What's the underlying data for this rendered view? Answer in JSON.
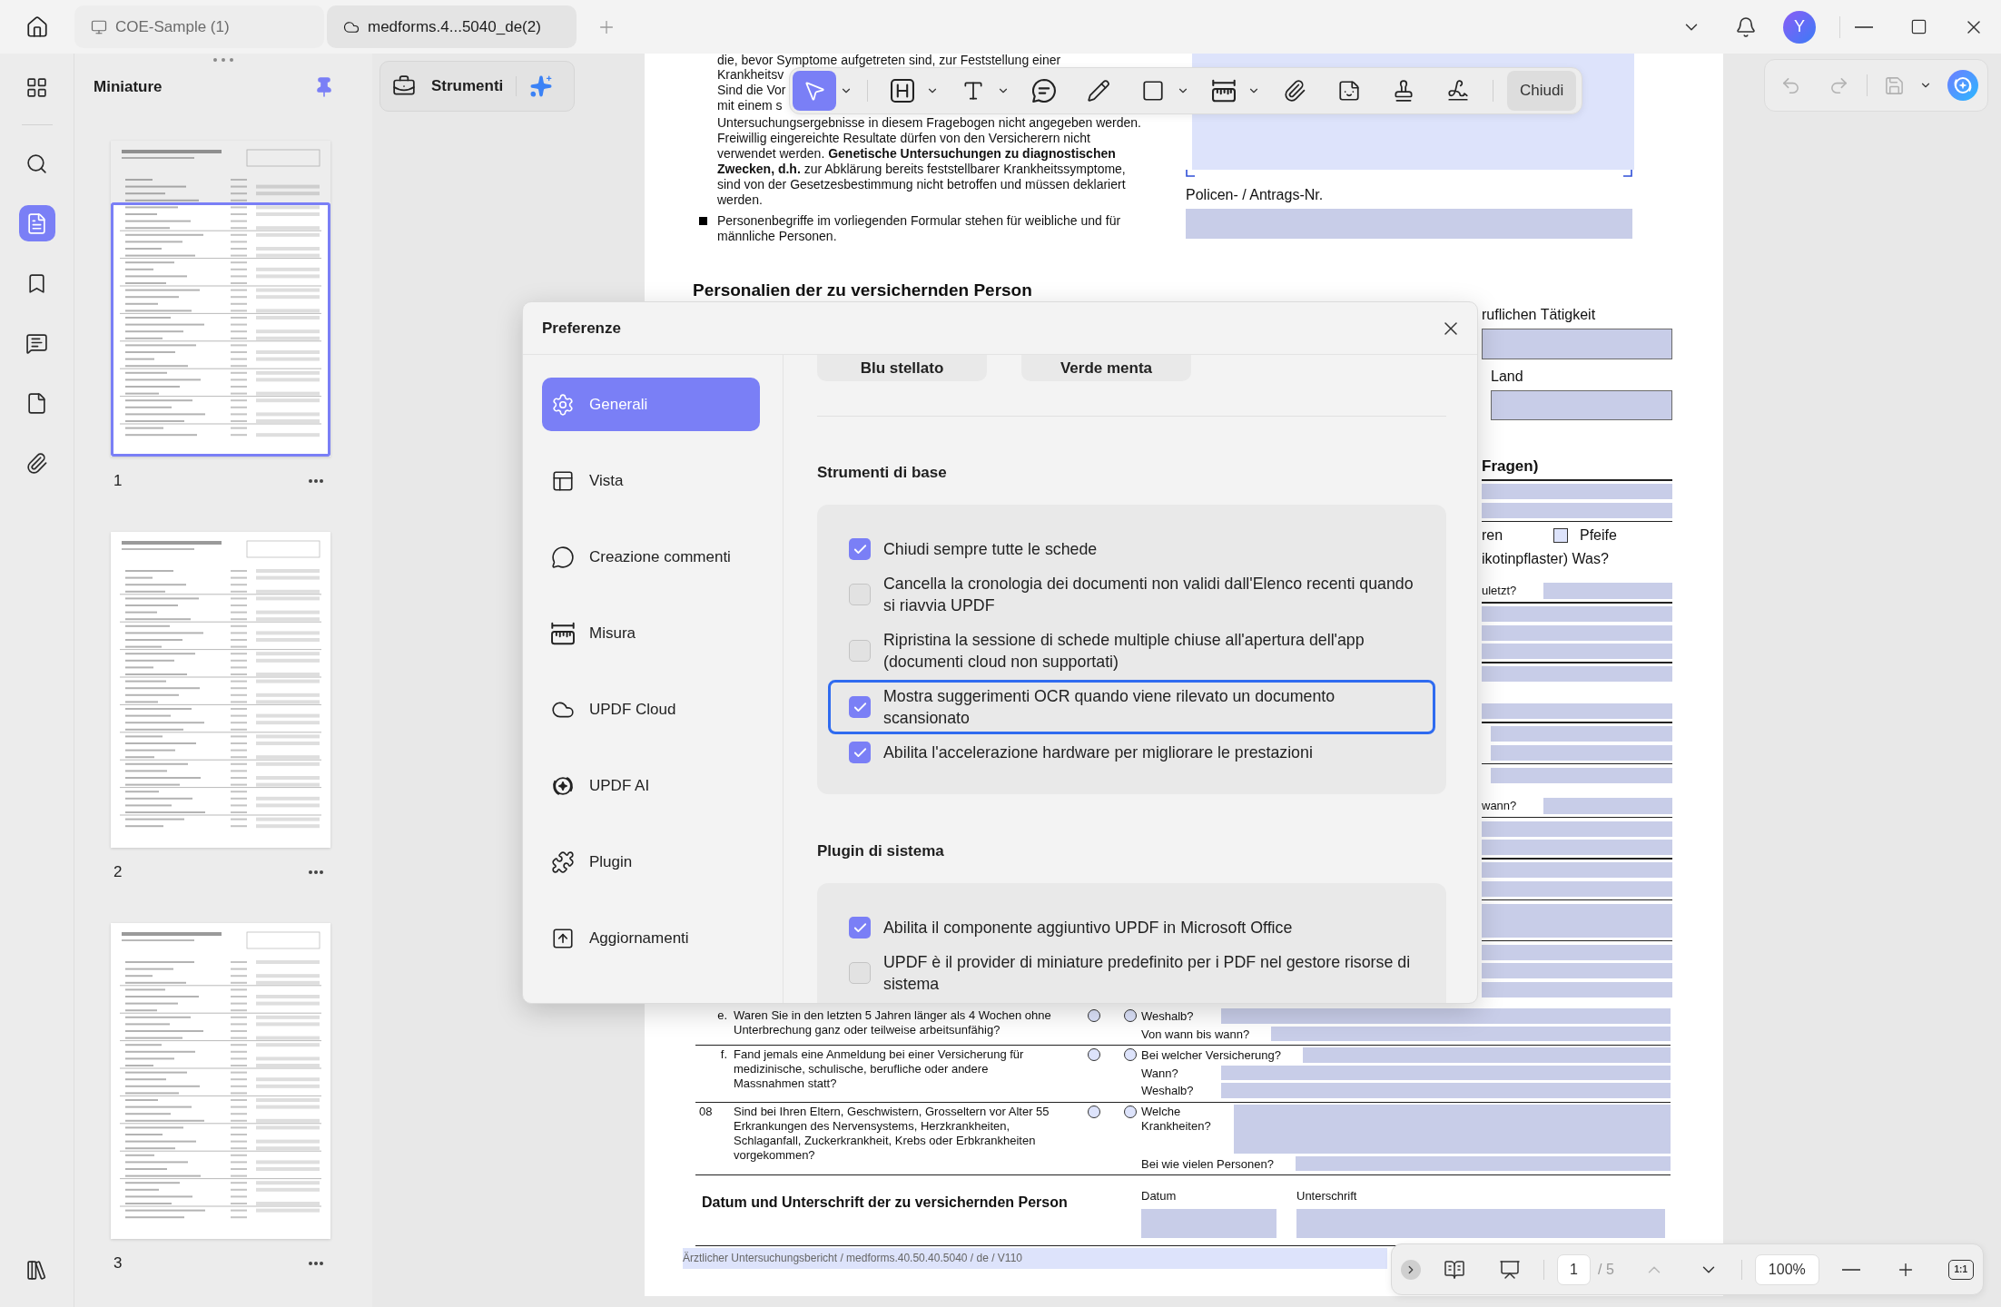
{
  "title_bar": {
    "tabs": [
      {
        "kind": "local",
        "label": "COE-Sample (1)",
        "selected": false
      },
      {
        "kind": "cloud",
        "label": "medforms.4...5040_de(2)",
        "selected": true
      }
    ],
    "avatar": "Y"
  },
  "rail": [
    {
      "kind": "apps",
      "selected": false
    },
    {
      "kind": "search",
      "selected": false
    },
    {
      "kind": "pages",
      "selected": true
    },
    {
      "kind": "bookmarks",
      "selected": false
    },
    {
      "kind": "comments",
      "selected": false
    },
    {
      "kind": "forms",
      "selected": false
    },
    {
      "kind": "attachments",
      "selected": false
    },
    {
      "kind": "library",
      "selected": false
    }
  ],
  "thumbnails": {
    "title": "Miniature",
    "pinned": true,
    "pages": [
      {
        "label": "1",
        "selected": true
      },
      {
        "label": "2",
        "selected": false
      },
      {
        "label": "3",
        "selected": false
      }
    ]
  },
  "tools_button": {
    "label": "Strumenti"
  },
  "toolbar": {
    "tools": [
      {
        "kind": "select",
        "selected": true,
        "has_menu": true
      },
      {
        "kind": "text_box",
        "selected": false,
        "has_menu": true
      },
      {
        "kind": "text",
        "selected": false,
        "has_menu": true
      },
      {
        "kind": "comment",
        "selected": false,
        "has_menu": false
      },
      {
        "kind": "pencil",
        "selected": false,
        "has_menu": false
      },
      {
        "kind": "shape",
        "selected": false,
        "has_menu": true
      },
      {
        "kind": "measure",
        "selected": false,
        "has_menu": true
      },
      {
        "kind": "attach",
        "selected": false,
        "has_menu": false
      },
      {
        "kind": "sticker",
        "selected": false,
        "has_menu": false
      },
      {
        "kind": "stamp",
        "selected": false,
        "has_menu": false
      },
      {
        "kind": "signature",
        "selected": false,
        "has_menu": false
      }
    ],
    "close_label": "Chiudi"
  },
  "history": [
    {
      "kind": "undo",
      "disabled": true
    },
    {
      "kind": "redo",
      "disabled": true
    },
    {
      "kind": "save",
      "disabled": true
    }
  ],
  "document": {
    "intro_lines": [
      "die, bevor Symptome aufgetreten sind, zur Feststellung einer",
      "Krankheitsv",
      "Sind die Vor",
      "mit einem s"
    ],
    "paragraph_lines": [
      "Untersuchungsergebnisse in diesem Fragebogen nicht angegeben werden.",
      "Freiwillig eingereichte Resultate dürfen von den Versicherern nicht",
      "verwendet werden. **Genetische Untersuchungen zu diagnostischen**",
      "**Zwecken, d.h.** zur Abklärung bereits feststellbarer Krankheitssymptome,",
      "sind von der Gesetzesbestimmung nicht betroffen und müssen deklariert",
      "werden."
    ],
    "bullet_lines": [
      "Personenbegriffe im vorliegenden Formular stehen für weibliche und für",
      "männliche Personen."
    ],
    "policy_label": "Policen- / Antrags-Nr.",
    "section_title": "Personalien der zu versichernden Person",
    "side_rows": [
      {
        "kind": "label",
        "text": "ruflichen Tätigkeit"
      },
      {
        "kind": "field_boxed"
      },
      {
        "kind": "label_inset",
        "text": "Land"
      },
      {
        "kind": "field_boxed_inset"
      },
      {
        "kind": "heading",
        "text": "Fragen)"
      },
      {
        "kind": "rule"
      },
      {
        "kind": "field"
      },
      {
        "kind": "field"
      },
      {
        "kind": "rule"
      },
      {
        "kind": "check_row",
        "text": "ren",
        "option": {
          "label": "Pfeife",
          "checked": false
        }
      },
      {
        "kind": "label",
        "text": "ikotinpflaster) Was?"
      },
      {
        "kind": "label_field",
        "text": "uletzt?"
      },
      {
        "kind": "rule"
      },
      {
        "kind": "field"
      },
      {
        "kind": "field"
      },
      {
        "kind": "field"
      },
      {
        "kind": "rule"
      },
      {
        "kind": "field"
      },
      {
        "kind": "field_spaced"
      },
      {
        "kind": "rule"
      },
      {
        "kind": "field_inset"
      },
      {
        "kind": "field_inset"
      },
      {
        "kind": "rule"
      },
      {
        "kind": "field_inset"
      },
      {
        "kind": "label_field",
        "text": "wann?"
      },
      {
        "kind": "rule"
      },
      {
        "kind": "field"
      },
      {
        "kind": "field"
      },
      {
        "kind": "rule"
      },
      {
        "kind": "field"
      },
      {
        "kind": "field"
      },
      {
        "kind": "rule"
      },
      {
        "kind": "field_tall"
      },
      {
        "kind": "rule"
      },
      {
        "kind": "field"
      },
      {
        "kind": "field"
      },
      {
        "kind": "field"
      }
    ],
    "questions": [
      {
        "kind": "sub",
        "number": "e.",
        "lines": [
          "Waren Sie in den letzten 5 Jahren länger als 4 Wochen ohne",
          "Unterbrechung ganz oder teilweise arbeitsunfähig?"
        ],
        "choices": [
          {
            "selected": false
          },
          {
            "selected": false
          }
        ],
        "answers": [
          {
            "kind": "line",
            "label": "Weshalb?"
          },
          {
            "kind": "line",
            "label": "Von wann bis wann?"
          }
        ]
      },
      {
        "kind": "sub",
        "number": "f.",
        "lines": [
          "Fand jemals eine Anmeldung bei einer Versicherung für",
          "medizinische, schulische, berufliche oder andere",
          "Massnahmen statt?"
        ],
        "choices": [
          {
            "selected": false
          },
          {
            "selected": false
          }
        ],
        "answers": [
          {
            "kind": "line",
            "label": "Bei welcher Versicherung?"
          },
          {
            "kind": "line",
            "label": "Wann?"
          },
          {
            "kind": "line",
            "label": "Weshalb?"
          }
        ]
      },
      {
        "kind": "main",
        "number": "08",
        "lines": [
          "Sind bei Ihren Eltern, Geschwistern, Grosseltern vor Alter 55",
          "Erkrankungen des Nervensystems, Herzkrankheiten,",
          "Schlaganfall, Zuckerkrankheit, Krebs oder Erbkrankheiten",
          "vorgekommen?"
        ],
        "choices": [
          {
            "selected": false
          },
          {
            "selected": false
          }
        ],
        "answers": [
          {
            "kind": "box",
            "label": "Welche Krankheiten?"
          },
          {
            "kind": "line",
            "label": "Bei wie vielen Personen?"
          }
        ]
      }
    ],
    "signature": {
      "title": "Datum und Unterschrift der zu versichernden Person",
      "fields": [
        {
          "kind": "date",
          "label": "Datum"
        },
        {
          "kind": "sign",
          "label": "Unterschrift"
        }
      ]
    },
    "footer": "Ärztlicher Untersuchungsbericht / medforms.40.50.40.5040 / de / V110"
  },
  "dialog": {
    "title": "Preferenze",
    "nav": [
      {
        "kind": "general",
        "label": "Generali",
        "selected": true
      },
      {
        "kind": "view",
        "label": "Vista",
        "selected": false
      },
      {
        "kind": "comments",
        "label": "Creazione commenti",
        "selected": false
      },
      {
        "kind": "measure",
        "label": "Misura",
        "selected": false
      },
      {
        "kind": "cloud",
        "label": "UPDF Cloud",
        "selected": false
      },
      {
        "kind": "ai",
        "label": "UPDF AI",
        "selected": false
      },
      {
        "kind": "plugin",
        "label": "Plugin",
        "selected": false
      },
      {
        "kind": "updates",
        "label": "Aggiornamenti",
        "selected": false
      }
    ],
    "themes": [
      {
        "label": "Blu stellato"
      },
      {
        "label": "Verde menta"
      }
    ],
    "sections": [
      {
        "title": "Strumenti di base",
        "options": [
          {
            "label": "Chiudi sempre tutte le schede",
            "checked": true,
            "focused": false
          },
          {
            "label": "Cancella la cronologia dei documenti non validi dall'Elenco recenti quando si riavvia UPDF",
            "checked": false,
            "focused": false
          },
          {
            "label": "Ripristina la sessione di schede multiple chiuse all'apertura dell'app (documenti cloud non supportati)",
            "checked": false,
            "focused": false
          },
          {
            "label": "Mostra suggerimenti OCR quando viene rilevato un documento scansionato",
            "checked": true,
            "focused": true
          },
          {
            "label": "Abilita l'accelerazione hardware per migliorare le prestazioni",
            "checked": true,
            "focused": false
          }
        ]
      },
      {
        "title": "Plugin di sistema",
        "options": [
          {
            "label": "Abilita il componente aggiuntivo UPDF in Microsoft Office",
            "checked": true,
            "focused": false
          },
          {
            "label": "UPDF è il provider di miniature predefinito per i PDF nel gestore risorse di sistema",
            "checked": false,
            "focused": false
          }
        ]
      }
    ]
  },
  "page_nav": {
    "page": "1",
    "total": "/ 5",
    "zoom": "100%",
    "fit_label": "1:1",
    "prev_disabled": true,
    "next_disabled": false
  }
}
